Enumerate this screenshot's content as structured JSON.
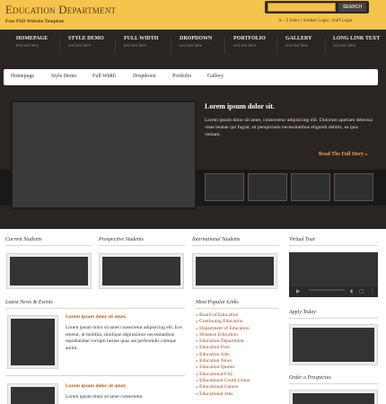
{
  "header": {
    "title": "Education Department",
    "subtitle": "Free PSD Website Template",
    "search_button": "SEARCH",
    "search_placeholder": "",
    "top_links": [
      "A – Z Index",
      "Student Login",
      "Staff Login"
    ]
  },
  "main_nav": [
    {
      "label": "HOMEPAGE",
      "sub": "text text here"
    },
    {
      "label": "STYLE DEMO",
      "sub": "text text here"
    },
    {
      "label": "FULL WIDTH",
      "sub": "text text here"
    },
    {
      "label": "DROPDOWN",
      "sub": "text text here"
    },
    {
      "label": "PORTFOLIO",
      "sub": "text text here"
    },
    {
      "label": "GALLERY",
      "sub": "text text here"
    },
    {
      "label": "LONG LINK TEXT",
      "sub": "text text here"
    }
  ],
  "sub_nav": [
    "Homepage",
    "Style Demo",
    "Full Width",
    "Dropdown",
    "Portfolio",
    "Gallery"
  ],
  "featured": {
    "title": "Lorem ipsum dolor sit.",
    "text": "Lorem ipsum dolor sit amet, consectetur adipisicing elit. Dolorum aperiam delectus vitae beatae qui fugiat, sit perspiciatis necessitatibus eligendi debitis, ea ipsa veniam.",
    "read_more": "Read The Full Story »"
  },
  "sections": {
    "current_students": "Current Students",
    "prospective_students": "Prospective Students",
    "international_students": "International Students",
    "virtual_tour": "Virtual Tour",
    "latest_news": "Latest News & Events",
    "popular_links": "Most Popular Links",
    "apply_today": "Apply Today",
    "order_prospectus": "Order a Prospectus"
  },
  "news": [
    {
      "title": "Lorem ipsum dolor sit amet.",
      "text": "Lorem ipsum dolor sit amet consectetur adipisicing elit. Eos tenetur, ut mollitia, similique dignissimos necessitatibus repudiandae corrupti beatae quas aut perferendis cumque animi."
    },
    {
      "title": "Lorem ipsum dolor sit amet.",
      "text": "Lorem ipsum dolor sit amet consectetur"
    }
  ],
  "popular_links": [
    "Board of Education",
    "Continuing Education",
    "Department of Education",
    "Distance Education",
    "Education Department",
    "Education First",
    "Education Jobs",
    "Education News",
    "Education Quotes",
    "Educational City",
    "Educational Credit Union",
    "Educational Games",
    "Educational Jobs"
  ],
  "colors": {
    "header_bg": "#f5c44c",
    "dark_bg": "#2a2522",
    "accent_link": "#c4541a",
    "read_more": "#f0a54a"
  }
}
